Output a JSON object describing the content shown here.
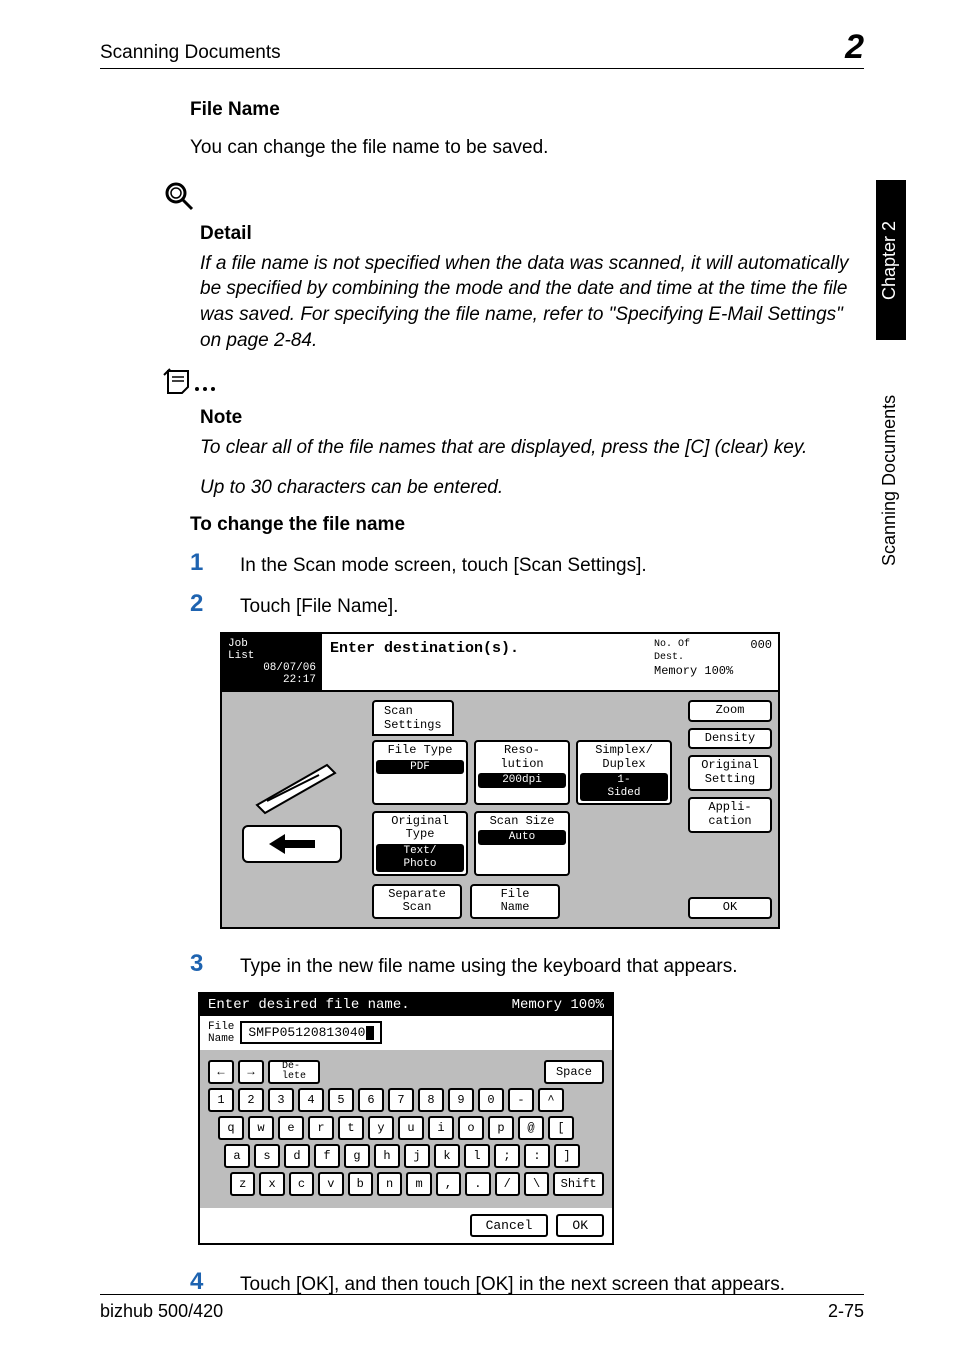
{
  "runningHead": {
    "title": "Scanning Documents",
    "chapterNumber": "2"
  },
  "sidetab": {
    "black": "Chapter 2",
    "white": "Scanning Documents"
  },
  "fileName": {
    "heading": "File Name",
    "intro": "You can change the file name to be saved."
  },
  "detail": {
    "heading": "Detail",
    "body": "If a file name is not specified when the data was scanned, it will automatically be specified by combining the mode and the date and time at the time the file was saved. For specifying the file name, refer to \"Specifying E-Mail Settings\" on page 2-84."
  },
  "note": {
    "heading": "Note",
    "body1": "To clear all of the file names that are displayed, press the [C] (clear) key.",
    "body2": "Up to 30 characters can be entered."
  },
  "procedure": {
    "heading": "To change the file name",
    "steps": [
      "In the Scan mode screen, touch [Scan Settings].",
      "Touch [File Name].",
      "Type in the new file name using the keyboard that appears.",
      "Touch [OK], and then touch [OK] in the next screen that appears."
    ]
  },
  "screen1": {
    "jobListLabel": "Job\nList",
    "dateTime": "08/07/06\n22:17",
    "prompt": "Enter destination(s).",
    "statusLine1": "No. Of\nDest.",
    "statusCount": "000",
    "statusLine2": "Memory 100%",
    "tab": "Scan\nSettings",
    "buttons": {
      "fileType": {
        "label": "File Type",
        "value": "PDF"
      },
      "resolution": {
        "label": "Reso-\nlution",
        "value": "200dpi"
      },
      "simplex": {
        "label": "Simplex/\nDuplex",
        "value": "1-\nSided"
      },
      "originalType": {
        "label": "Original\nType",
        "value": "Text/\nPhoto"
      },
      "scanSize": {
        "label": "Scan Size",
        "value": "Auto"
      },
      "separateScan": "Separate\nScan",
      "fileName": "File\nName",
      "zoom": "Zoom",
      "density": "Density",
      "originalSetting": "Original\nSetting",
      "application": "Appli-\ncation",
      "ok": "OK"
    }
  },
  "screen2": {
    "prompt": "Enter desired file name.",
    "memory": "Memory 100%",
    "fieldLabel": "File\nName",
    "fieldValue": "SMFP05120813040",
    "topKeys": {
      "left": "←",
      "right": "→",
      "delete": "De-\nlete",
      "space": "Space"
    },
    "rows": [
      [
        "1",
        "2",
        "3",
        "4",
        "5",
        "6",
        "7",
        "8",
        "9",
        "0",
        "-",
        "^"
      ],
      [
        "q",
        "w",
        "e",
        "r",
        "t",
        "y",
        "u",
        "i",
        "o",
        "p",
        "@",
        "["
      ],
      [
        "a",
        "s",
        "d",
        "f",
        "g",
        "h",
        "j",
        "k",
        "l",
        ";",
        ":",
        "]"
      ],
      [
        "z",
        "x",
        "c",
        "v",
        "b",
        "n",
        "m",
        ",",
        ".",
        "/",
        "\\",
        "Shift"
      ]
    ],
    "cancel": "Cancel",
    "ok": "OK"
  },
  "footer": {
    "model": "bizhub 500/420",
    "page": "2-75"
  }
}
